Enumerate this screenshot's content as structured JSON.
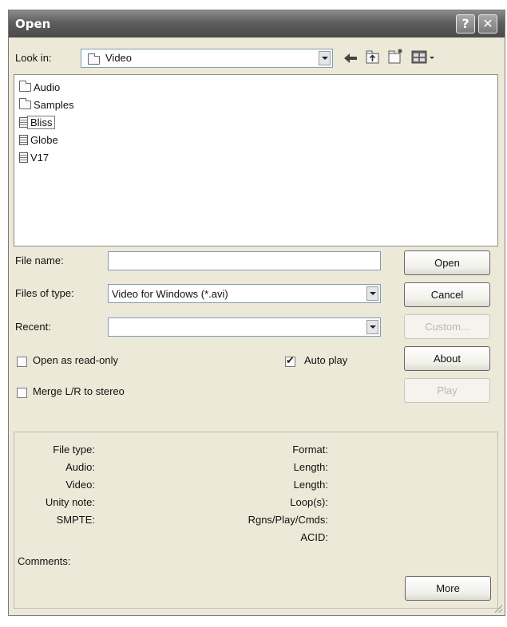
{
  "window": {
    "title": "Open",
    "help_label": "?",
    "close_label": "✕"
  },
  "lookin": {
    "label": "Look in:",
    "value": "Video"
  },
  "files": [
    {
      "name": "Audio",
      "kind": "folder"
    },
    {
      "name": "Samples",
      "kind": "folder"
    },
    {
      "name": "Bliss",
      "kind": "video",
      "selected": true
    },
    {
      "name": "Globe",
      "kind": "video"
    },
    {
      "name": "V17",
      "kind": "video"
    }
  ],
  "form": {
    "filename_label": "File name:",
    "filename_value": "",
    "filetype_label": "Files of type:",
    "filetype_value": "Video for Windows (*.avi)",
    "recent_label": "Recent:",
    "recent_value": ""
  },
  "buttons": {
    "open": "Open",
    "cancel": "Cancel",
    "custom": "Custom...",
    "about": "About",
    "play": "Play",
    "more": "More"
  },
  "options": {
    "readonly_label": "Open as read-only",
    "readonly_checked": false,
    "merge_label": "Merge L/R to stereo",
    "merge_checked": false,
    "autoplay_label": "Auto play",
    "autoplay_checked": true
  },
  "info": {
    "left_labels": [
      "File type:",
      "Audio:",
      "Video:",
      "Unity note:",
      "SMPTE:"
    ],
    "right_labels": [
      "Format:",
      "Length:",
      "Length:",
      "Loop(s):",
      "Rgns/Play/Cmds:",
      "ACID:"
    ],
    "comments_label": "Comments:"
  },
  "icons": {
    "back": "back-arrow-icon",
    "up": "up-folder-icon",
    "new_folder": "new-folder-icon",
    "views": "view-menu-icon"
  }
}
